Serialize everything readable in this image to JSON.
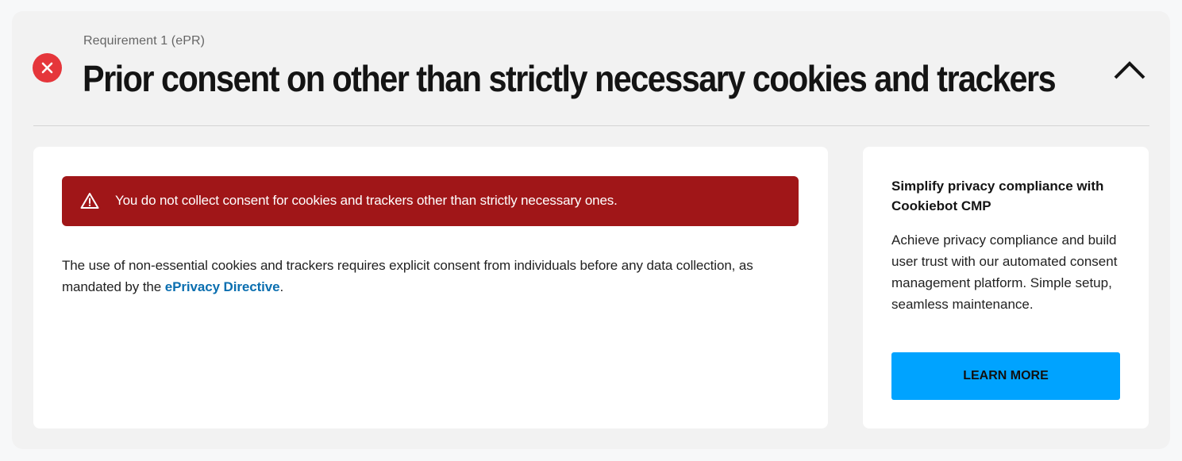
{
  "requirement": {
    "label": "Requirement 1 (ePR)",
    "title": "Prior consent on other than strictly necessary cookies and trackers",
    "status_icon": "close-circle-icon",
    "status_color": "#e5363b",
    "toggle_icon": "chevron-up-icon"
  },
  "alert": {
    "icon": "warning-triangle-icon",
    "text": "You do not collect consent for cookies and trackers other than strictly necessary ones.",
    "color": "#a01618"
  },
  "body": {
    "text_before_link": "The use of non-essential cookies and trackers requires explicit consent from individuals before any data collection, as mandated by the ",
    "link_text": "ePrivacy Directive",
    "text_after_link": ".",
    "link_color": "#0b6fb0"
  },
  "promo": {
    "title": "Simplify privacy compliance with Cookiebot CMP",
    "description": "Achieve privacy compliance and build user trust with our automated consent management platform. Simple setup, seamless maintenance.",
    "button_label": "LEARN MORE",
    "button_color": "#00a3ff"
  }
}
